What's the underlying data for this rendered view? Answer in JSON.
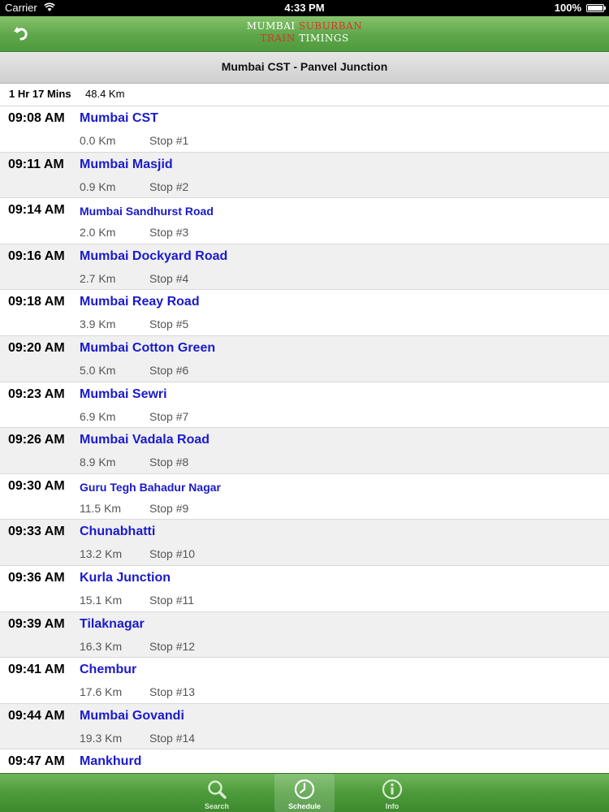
{
  "status_bar": {
    "carrier": "Carrier",
    "time": "4:33 PM",
    "battery": "100%"
  },
  "nav": {
    "back_icon": "undo-arrow-icon",
    "logo_line1_white": "MUMBAI",
    "logo_line1_red": "SUBURBAN",
    "logo_line2_red": "TRAIN",
    "logo_line2_white": "TIMINGS"
  },
  "route": {
    "title": "Mumbai CST - Panvel Junction",
    "duration": "1 Hr 17 Mins",
    "distance": "48.4 Km"
  },
  "stops": [
    {
      "time": "09:08 AM",
      "name": "Mumbai CST",
      "km": "0.0 Km",
      "stop": "Stop #1"
    },
    {
      "time": "09:11 AM",
      "name": "Mumbai Masjid",
      "km": "0.9 Km",
      "stop": "Stop #2"
    },
    {
      "time": "09:14 AM",
      "name": "Mumbai Sandhurst Road",
      "km": "2.0 Km",
      "stop": "Stop #3"
    },
    {
      "time": "09:16 AM",
      "name": "Mumbai Dockyard Road",
      "km": "2.7 Km",
      "stop": "Stop #4"
    },
    {
      "time": "09:18 AM",
      "name": "Mumbai Reay Road",
      "km": "3.9 Km",
      "stop": "Stop #5"
    },
    {
      "time": "09:20 AM",
      "name": "Mumbai Cotton Green",
      "km": "5.0 Km",
      "stop": "Stop #6"
    },
    {
      "time": "09:23 AM",
      "name": "Mumbai Sewri",
      "km": "6.9 Km",
      "stop": "Stop #7"
    },
    {
      "time": "09:26 AM",
      "name": "Mumbai Vadala Road",
      "km": "8.9 Km",
      "stop": "Stop #8"
    },
    {
      "time": "09:30 AM",
      "name": "Guru Tegh Bahadur Nagar",
      "km": "11.5 Km",
      "stop": "Stop #9"
    },
    {
      "time": "09:33 AM",
      "name": "Chunabhatti",
      "km": "13.2 Km",
      "stop": "Stop #10"
    },
    {
      "time": "09:36 AM",
      "name": "Kurla Junction",
      "km": "15.1 Km",
      "stop": "Stop #11"
    },
    {
      "time": "09:39 AM",
      "name": "Tilaknagar",
      "km": "16.3 Km",
      "stop": "Stop #12"
    },
    {
      "time": "09:41 AM",
      "name": "Chembur",
      "km": "17.6 Km",
      "stop": "Stop #13"
    },
    {
      "time": "09:44 AM",
      "name": "Mumbai Govandi",
      "km": "19.3 Km",
      "stop": "Stop #14"
    },
    {
      "time": "09:47 AM",
      "name": "Mankhurd",
      "km": "",
      "stop": ""
    }
  ],
  "tabbar": {
    "search": {
      "label": "Search",
      "icon": "search-icon"
    },
    "schedule": {
      "label": "Schedule",
      "icon": "clock-icon",
      "active": true
    },
    "info": {
      "label": "Info",
      "icon": "info-icon"
    }
  },
  "colors": {
    "nav_green": "#5ea64a",
    "station_blue": "#1a1acc",
    "logo_red": "#d8352a"
  }
}
